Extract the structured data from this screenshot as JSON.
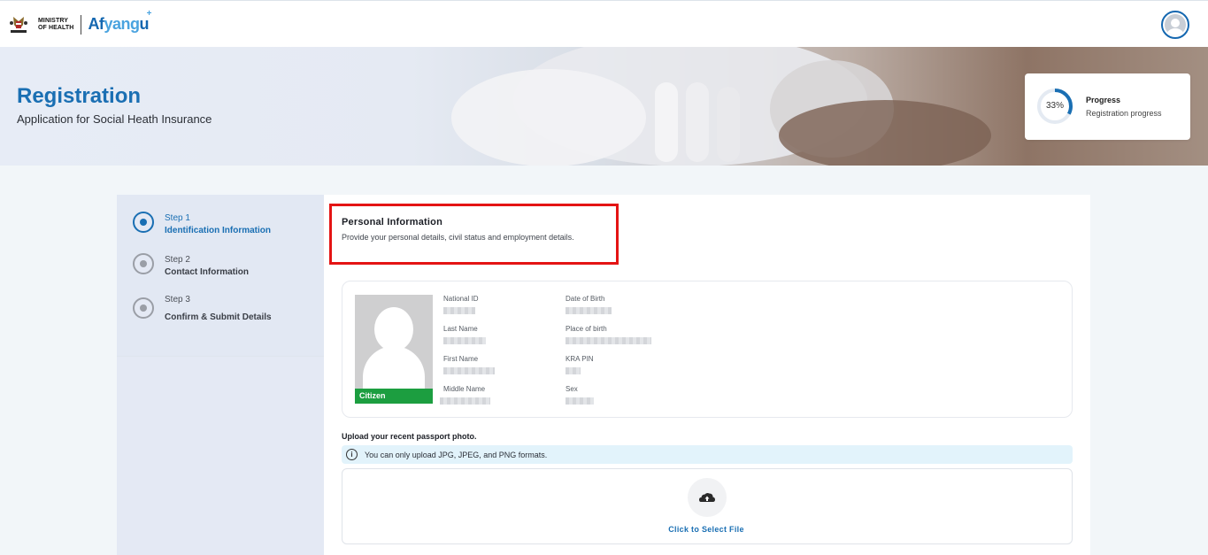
{
  "header": {
    "ministry_line1": "MINISTRY",
    "ministry_line2": "OF HEALTH",
    "brand_prefix": "Af",
    "brand_mid": "yang",
    "brand_suffix": "u",
    "brand_plus": "+"
  },
  "hero": {
    "title": "Registration",
    "subtitle": "Application for Social Heath Insurance",
    "progress": {
      "percent_text": "33%",
      "value": 33,
      "title": "Progress",
      "label": "Registration progress"
    }
  },
  "steps": [
    {
      "number": "Step 1",
      "name": "Identification Information",
      "active": true
    },
    {
      "number": "Step 2",
      "name": "Contact Information",
      "active": false
    },
    {
      "number": "Step 3",
      "name": "Confirm & Submit Details",
      "active": false
    }
  ],
  "personal_info": {
    "title": "Personal Information",
    "subtitle": "Provide your personal details, civil status and employment details."
  },
  "id_card": {
    "badge": "Citizen",
    "fields": {
      "national_id": "National ID",
      "last_name": "Last Name",
      "first_name": "First Name",
      "middle_name": "Middle Name",
      "date_of_birth": "Date of Birth",
      "place_of_birth": "Place of birth",
      "kra_pin": "KRA PIN",
      "sex": "Sex"
    }
  },
  "upload": {
    "label": "Upload your recent passport photo.",
    "info": "You can only upload JPG, JPEG, and PNG formats.",
    "action": "Click to Select File"
  },
  "colors": {
    "accent": "#1a6fb3",
    "highlight_border": "#e41414",
    "citizen_badge": "#1c9e40"
  }
}
